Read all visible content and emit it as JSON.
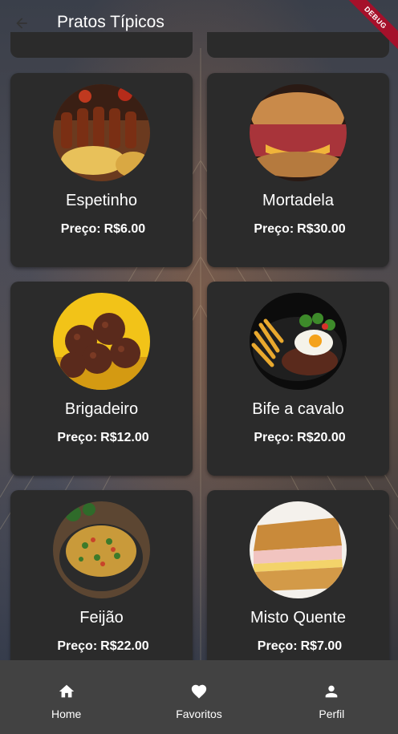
{
  "app_bar": {
    "title": "Pratos Típicos",
    "back_icon": "arrow-back-icon",
    "debug_banner": "DEBUG"
  },
  "dishes": [
    {
      "name": "Espetinho",
      "price_label": "Preço:",
      "price": "R$6.00",
      "image": "skewers-image"
    },
    {
      "name": "Mortadela",
      "price_label": "Preço:",
      "price": "R$30.00",
      "image": "mortadella-sandwich-image"
    },
    {
      "name": "Brigadeiro",
      "price_label": "Preço:",
      "price": "R$12.00",
      "image": "brigadeiro-image"
    },
    {
      "name": "Bife a cavalo",
      "price_label": "Preço:",
      "price": "R$20.00",
      "image": "steak-egg-fries-image"
    },
    {
      "name": "Feijão",
      "price_label": "Preço:",
      "price": "R$22.00",
      "image": "feijao-image"
    },
    {
      "name": "Misto Quente",
      "price_label": "Preço:",
      "price": "R$7.00",
      "image": "grilled-sandwich-image"
    }
  ],
  "bottom_nav": [
    {
      "label": "Home",
      "icon": "home-icon"
    },
    {
      "label": "Favoritos",
      "icon": "heart-icon"
    },
    {
      "label": "Perfil",
      "icon": "person-icon"
    }
  ],
  "colors": {
    "card_bg": "#2b2b2b",
    "nav_bg": "#424242",
    "text": "#ffffff",
    "debug_banner": "#a5102a"
  }
}
